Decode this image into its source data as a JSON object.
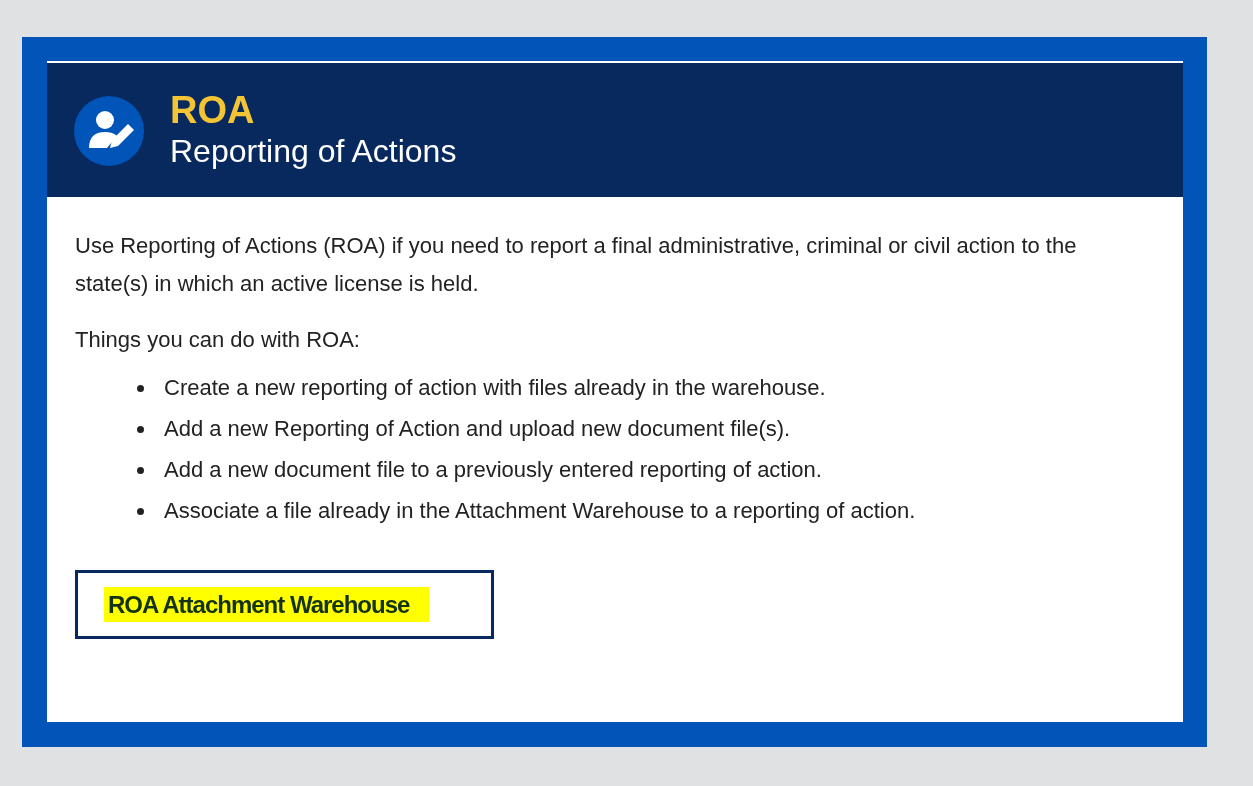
{
  "header": {
    "title": "ROA",
    "subtitle": "Reporting of Actions"
  },
  "intro": "Use Reporting of Actions (ROA) if you need to report a final administrative, criminal or civil action to the state(s) in which an active license is held.",
  "list_heading": "Things you can do with ROA:",
  "items": [
    "Create a new reporting of action with files already in the warehouse.",
    "Add a new Reporting of Action and upload new document file(s).",
    "Add a new document file to a previously entered reporting of action.",
    "Associate a file already in the Attachment Warehouse to a reporting of action."
  ],
  "button": {
    "label": "ROA Attachment Warehouse",
    "highlighted": true
  }
}
